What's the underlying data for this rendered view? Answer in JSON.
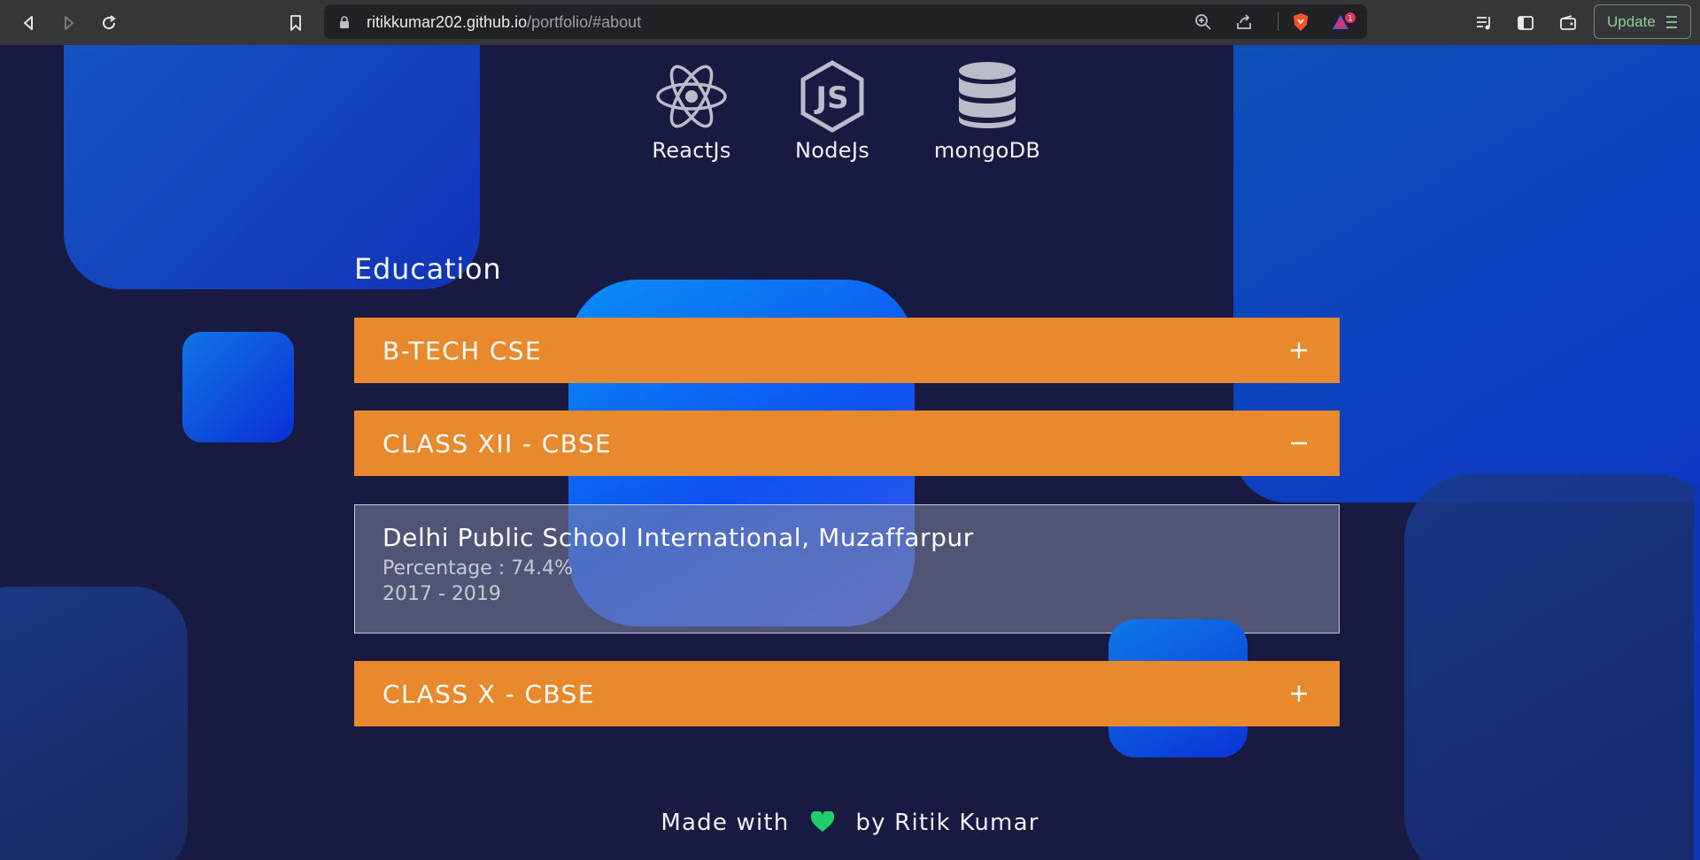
{
  "browser": {
    "url_host": "ritikkumar202.github.io",
    "url_path": "/portfolio/#about",
    "notification_count": "1",
    "update_label": "Update"
  },
  "skills": [
    {
      "label": "ReactJs",
      "icon": "react-icon"
    },
    {
      "label": "NodeJs",
      "icon": "nodejs-icon"
    },
    {
      "label": "mongoDB",
      "icon": "mongodb-icon"
    }
  ],
  "education": {
    "title": "Education",
    "items": [
      {
        "label": "B-TECH CSE",
        "state": "collapsed",
        "toggle": "+"
      },
      {
        "label": "CLASS XII - CBSE",
        "state": "expanded",
        "toggle": "−",
        "details": {
          "school": "Delhi Public School International, Muzaffarpur",
          "percentage": "Percentage : 74.4%",
          "years": "2017 - 2019"
        }
      },
      {
        "label": "CLASS X - CBSE",
        "state": "collapsed",
        "toggle": "+"
      }
    ]
  },
  "footer": {
    "made_with": "Made with",
    "by": "by Ritik Kumar"
  },
  "colors": {
    "background": "#181a42",
    "accordion": "#e8892e",
    "accent_blue": "#0d52f2",
    "heart": "#1fcf6a"
  }
}
